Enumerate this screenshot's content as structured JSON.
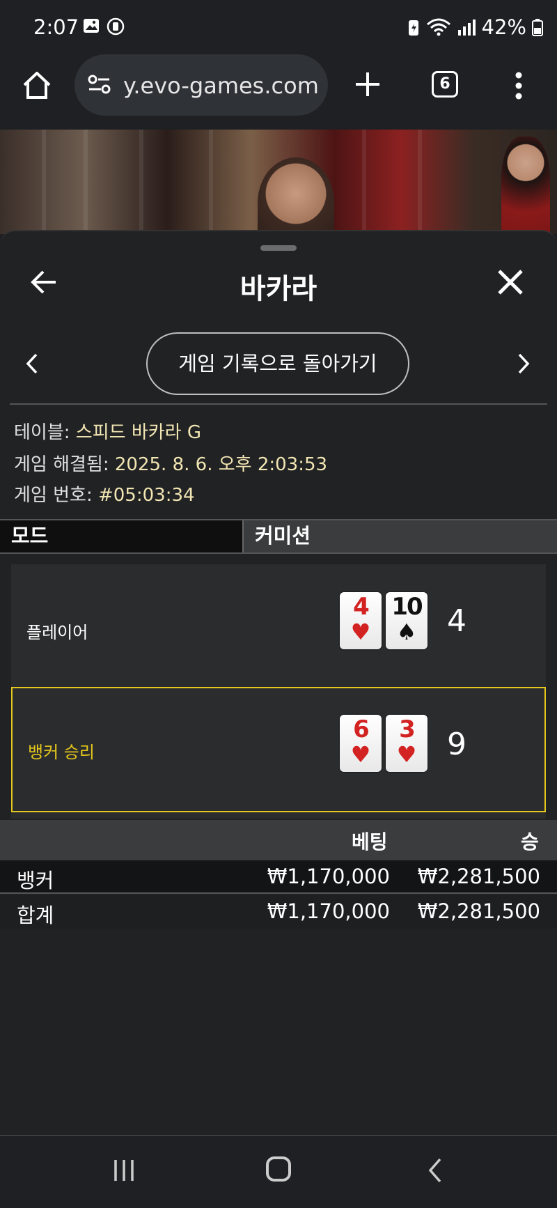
{
  "status_bar": {
    "time": "2:07",
    "battery": "42%"
  },
  "browser": {
    "url": "y.evo-games.com",
    "tab_count": "6"
  },
  "sheet": {
    "title": "바카라",
    "back_to_history": "게임 기록으로 돌아가기",
    "info": {
      "table_label": "테이블: ",
      "table_value": "스피드 바카라 G",
      "resolved_label": "게임 해결됨: ",
      "resolved_value": "2025. 8. 6. 오후 2:03:53",
      "number_label": "게임 번호: ",
      "number_value": "#05:03:34"
    },
    "tabs": {
      "mode": "모드",
      "commission": "커미션"
    },
    "hands": {
      "player": {
        "label": "플레이어",
        "cards": [
          {
            "rank": "4",
            "suit": "♥"
          },
          {
            "rank": "10",
            "suit": "♠"
          }
        ],
        "score": "4"
      },
      "banker": {
        "label": "뱅커 승리",
        "cards": [
          {
            "rank": "6",
            "suit": "♥"
          },
          {
            "rank": "3",
            "suit": "♥"
          }
        ],
        "score": "9"
      }
    },
    "bets": {
      "header_bet": "베팅",
      "header_win": "승",
      "rows": [
        {
          "name": "뱅커",
          "bet": "₩1,170,000",
          "win": "₩2,281,500"
        },
        {
          "name": "합계",
          "bet": "₩1,170,000",
          "win": "₩2,281,500"
        }
      ]
    }
  },
  "colors": {
    "accent_yellow": "#e4c61c",
    "card_red": "#d32222",
    "info_value": "#f2e6b3"
  }
}
